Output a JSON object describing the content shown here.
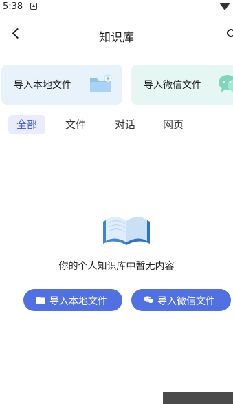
{
  "status_bar": {
    "time": "5:38",
    "notification_icon": "notification-icon",
    "wifi_icon": "wifi-icon"
  },
  "header": {
    "title": "知识库",
    "back_icon": "back-icon",
    "search_icon": "search-icon"
  },
  "import_cards": [
    {
      "label": "导入本地文件",
      "icon": "folder-add-icon",
      "color": "#e7f2fb"
    },
    {
      "label": "导入微信文件",
      "icon": "wechat-icon",
      "color": "#e6f7f3"
    }
  ],
  "tabs": [
    {
      "label": "全部",
      "active": true
    },
    {
      "label": "文件",
      "active": false
    },
    {
      "label": "对话",
      "active": false
    },
    {
      "label": "网页",
      "active": false
    }
  ],
  "empty_state": {
    "icon": "open-book-icon",
    "text": "你的个人知识库中暂无内容"
  },
  "actions": {
    "local_label": "导入本地文件",
    "local_icon": "folder-icon",
    "wechat_label": "导入微信文件",
    "wechat_icon": "wechat-icon"
  },
  "colors": {
    "accent": "#5170e2",
    "active_tab_bg": "#e8ecfb",
    "active_tab_text": "#4a62d8"
  }
}
